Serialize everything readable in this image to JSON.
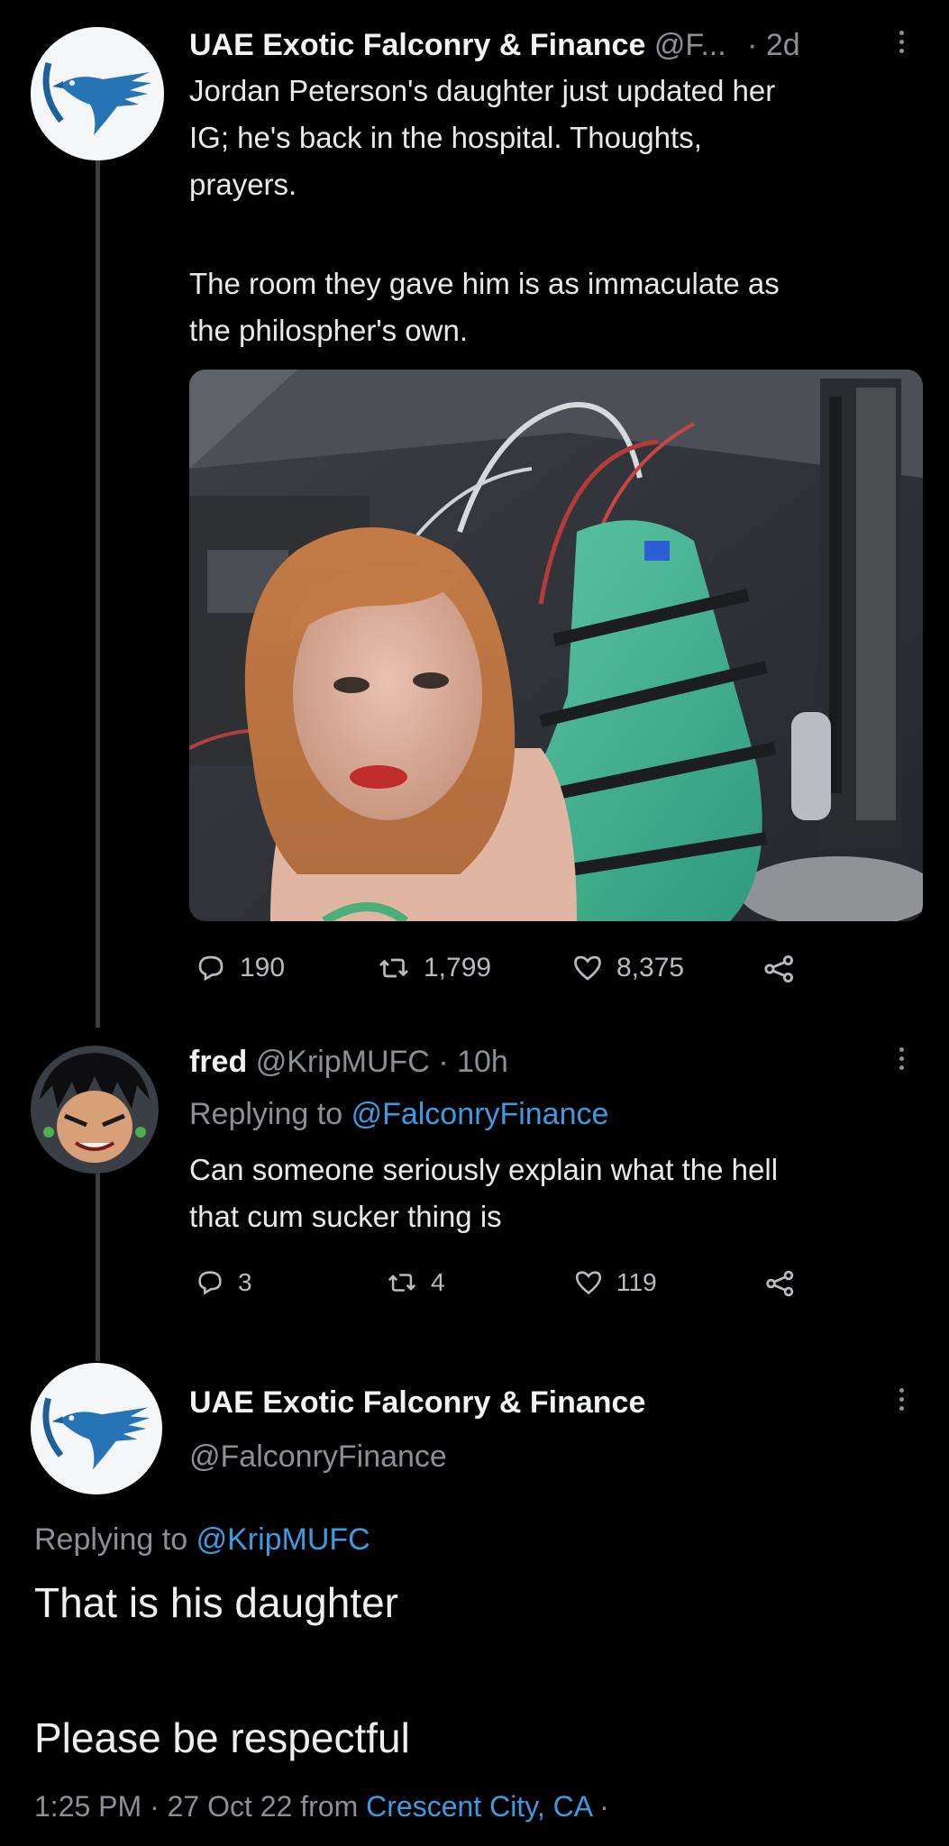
{
  "thread": {
    "tweet1": {
      "display_name": "UAE Exotic Falconry & Finance",
      "handle_truncated": "@F...",
      "time": "· 2d",
      "text_lines": [
        "Jordan Peterson's daughter just updated her",
        "IG; he's back in the hospital. Thoughts,",
        "prayers.",
        "The room they gave him is as immaculate as",
        "the philospher's own."
      ],
      "avatar_icon": "falcon-logo-icon",
      "media_icon": "photo-selfie-hospital-bed",
      "stats": {
        "replies": "190",
        "retweets": "1,799",
        "likes": "8,375"
      }
    },
    "tweet2": {
      "display_name": "fred",
      "handle": "@KripMUFC",
      "time": "· 10h",
      "replying_prefix": "Replying to",
      "replying_to": "@FalconryFinance",
      "text_lines": [
        "Can someone seriously explain what the hell",
        "that cum sucker thing is"
      ],
      "avatar_icon": "anime-character-avatar",
      "stats": {
        "replies": "3",
        "retweets": "4",
        "likes": "119"
      }
    },
    "tweet3": {
      "display_name": "UAE Exotic Falconry & Finance",
      "handle": "@FalconryFinance",
      "replying_prefix": "Replying to",
      "replying_to": "@KripMUFC",
      "text_lines": [
        "That is his daughter",
        "Please be respectful"
      ],
      "timestamp": "1:25 PM · 27 Oct 22 from",
      "location": "Crescent City, CA",
      "dot": "·",
      "avatar_icon": "falcon-logo-icon"
    }
  },
  "colors": {
    "background": "#000000",
    "text": "#e7e9ea",
    "muted": "#8b9096",
    "link": "#3d9be0",
    "thread_line": "#3a3d40"
  }
}
